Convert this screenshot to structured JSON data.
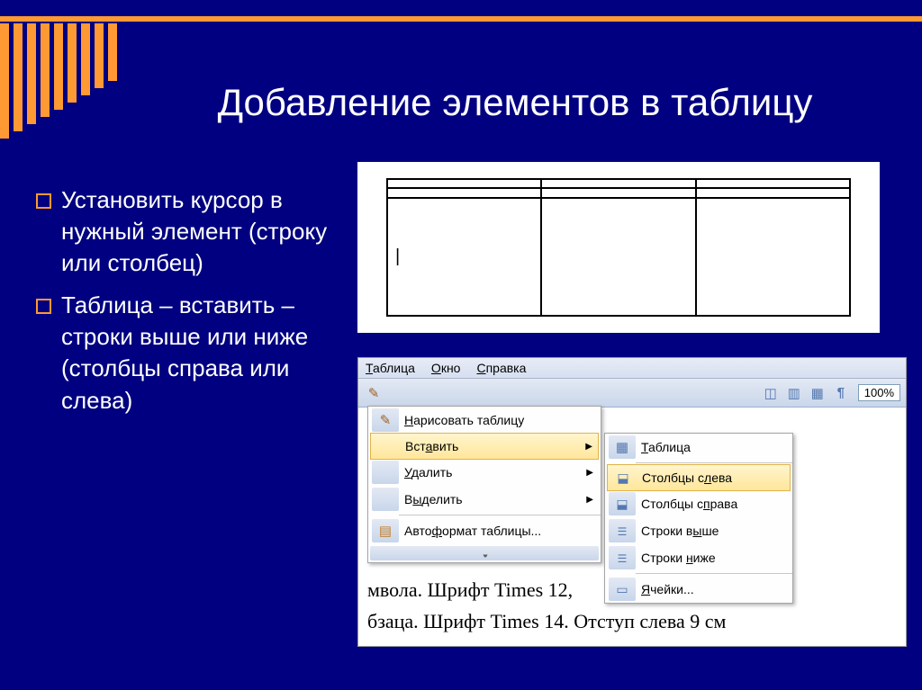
{
  "slide": {
    "title": "Добавление элементов в таблицу",
    "bullets": [
      "Установить курсор в нужный элемент (строку или столбец)",
      "Таблица – вставить – строки выше или ниже (столбцы справа или слева)"
    ],
    "cursor_cell": "|"
  },
  "menubar": {
    "table": "Таблица",
    "window": "Окно",
    "help": "Справка"
  },
  "toolbar": {
    "zoom": "100%"
  },
  "dropdown1": {
    "draw": "Нарисовать таблицу",
    "insert": "Вставить",
    "delete": "Удалить",
    "select": "Выделить",
    "autoformat": "Автоформат таблицы..."
  },
  "dropdown2": {
    "table": "Таблица",
    "cols_left": "Столбцы слева",
    "cols_right": "Столбцы справа",
    "rows_above": "Строки выше",
    "rows_below": "Строки ниже",
    "cells": "Ячейки..."
  },
  "doc": {
    "line1": "мвола. Шрифт Times 12,",
    "line2": "бзаца. Шрифт Times 14. Отступ слева 9 см"
  }
}
